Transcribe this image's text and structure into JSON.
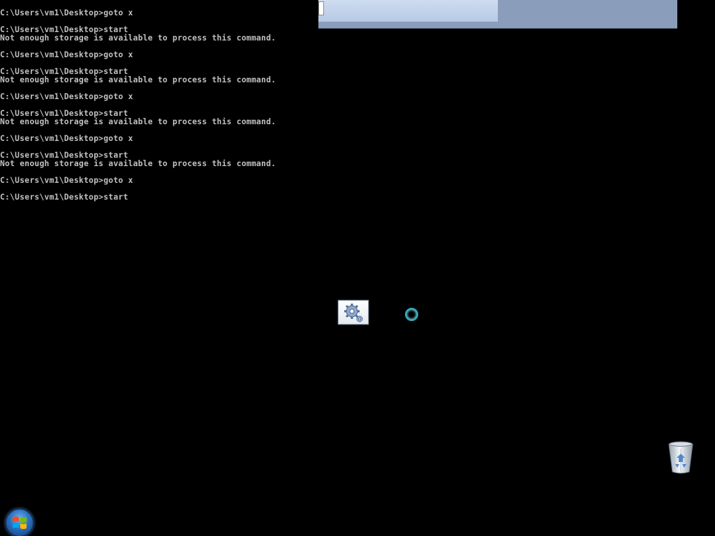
{
  "console": {
    "lines": [
      "C:\\Users\\vm1\\Desktop>goto x",
      "",
      "C:\\Users\\vm1\\Desktop>start",
      "Not enough storage is available to process this command.",
      "",
      "C:\\Users\\vm1\\Desktop>goto x",
      "",
      "C:\\Users\\vm1\\Desktop>start",
      "Not enough storage is available to process this command.",
      "",
      "C:\\Users\\vm1\\Desktop>goto x",
      "",
      "C:\\Users\\vm1\\Desktop>start",
      "Not enough storage is available to process this command.",
      "",
      "C:\\Users\\vm1\\Desktop>goto x",
      "",
      "C:\\Users\\vm1\\Desktop>start",
      "Not enough storage is available to process this command.",
      "",
      "C:\\Users\\vm1\\Desktop>goto x",
      "",
      "C:\\Users\\vm1\\Desktop>start"
    ]
  },
  "top_strip": {
    "progress_fraction": 0.5
  },
  "icons": {
    "gear_window": "gear-window-icon",
    "busy_cursor": "busy-ring-icon",
    "recycle_bin": "recycle-bin-icon",
    "start_orb": "windows-logo-icon"
  },
  "colors": {
    "console_text": "#c0c0c0",
    "background": "#000000",
    "strip": "#8a9dbb",
    "accent_ring": "#3aa6b8"
  }
}
